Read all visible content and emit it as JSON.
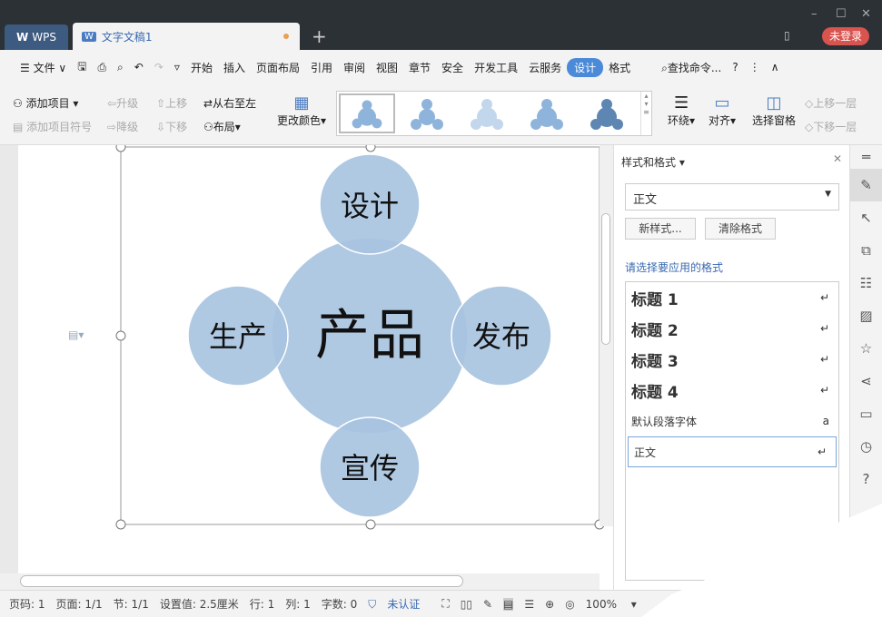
{
  "window": {
    "minimize": "–",
    "maximize": "☐",
    "close": "✕",
    "login": "未登录"
  },
  "tabs": {
    "wps": "WPS",
    "doc": "文字文稿1",
    "new": "+"
  },
  "menu": {
    "file": "文件",
    "items": [
      "开始",
      "插入",
      "页面布局",
      "引用",
      "审阅",
      "视图",
      "章节",
      "安全",
      "开发工具",
      "云服务",
      "设计",
      "格式"
    ],
    "active": "设计",
    "search": "查找命令...",
    "help": "?"
  },
  "ribbon": {
    "add_item": "添加项目",
    "add_bullet": "添加项目符号",
    "promote": "升级",
    "demote": "降级",
    "move_up": "上移",
    "move_down": "下移",
    "rtl": "从右至左",
    "layout": "布局",
    "change_color": "更改颜色",
    "wrap": "环绕",
    "align": "对齐",
    "selection_pane": "选择窗格",
    "bring_forward": "上移一层",
    "send_backward": "下移一层"
  },
  "diagram": {
    "center": "产品",
    "top": "设计",
    "left": "生产",
    "right": "发布",
    "bottom": "宣传",
    "fill": "#a7c3e0"
  },
  "pane": {
    "title": "样式和格式",
    "current": "正文",
    "new_style": "新样式...",
    "clear": "清除格式",
    "prompt": "请选择要应用的格式",
    "styles": [
      {
        "name": "标题 1",
        "mark": "↵",
        "bold": true
      },
      {
        "name": "标题 2",
        "mark": "↵",
        "bold": true
      },
      {
        "name": "标题 3",
        "mark": "↵",
        "bold": true
      },
      {
        "name": "标题 4",
        "mark": "↵",
        "bold": true
      },
      {
        "name": "默认段落字体",
        "mark": "a",
        "bold": false
      },
      {
        "name": "正文",
        "mark": "↵",
        "bold": false
      }
    ]
  },
  "status": {
    "page_no": "页码: 1",
    "pages": "页面: 1/1",
    "section": "节: 1/1",
    "setting": "设置值: 2.5厘米",
    "row": "行: 1",
    "col": "列: 1",
    "words": "字数: 0",
    "auth": "未认证",
    "zoom": "100%"
  }
}
